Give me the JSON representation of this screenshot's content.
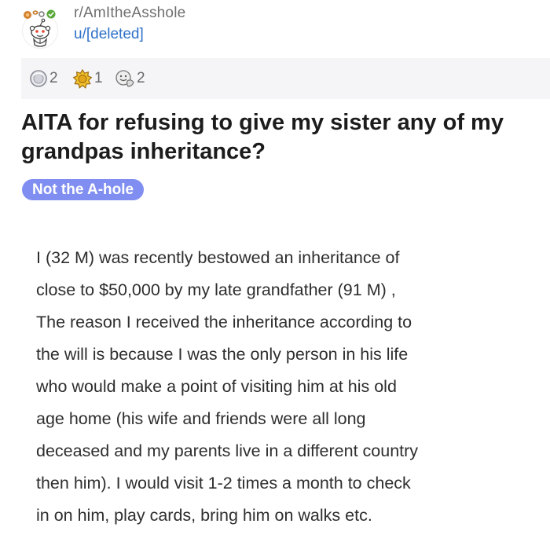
{
  "post": {
    "subreddit": "r/AmItheAsshole",
    "author": "u/[deleted]",
    "awards": [
      {
        "icon": "silver-award-icon",
        "count": "2"
      },
      {
        "icon": "gold-award-icon",
        "count": "1"
      },
      {
        "icon": "wholesome-award-icon",
        "count": "2"
      }
    ],
    "title": "AITA for refusing to give my sister any of my grandpas inheritance?",
    "flair": "Not the A-hole",
    "body": "I (32 M) was recently bestowed an inheritance of\nclose to $50,000 by my late grandfather (91 M) ,\nThe reason I received the inheritance according to\nthe will is because I was the only person in his life\nwho would make a point of visiting him at his old\nage home (his wife and friends were all long\ndeceased and my parents live in a different country\nthen him). I would visit 1-2 times a month to check\nin on him, play cards, bring him on walks etc."
  },
  "colors": {
    "flair_bg": "#7f8ef0",
    "author_link": "#2f72c9",
    "awards_bar_bg": "#f5f5f7"
  }
}
